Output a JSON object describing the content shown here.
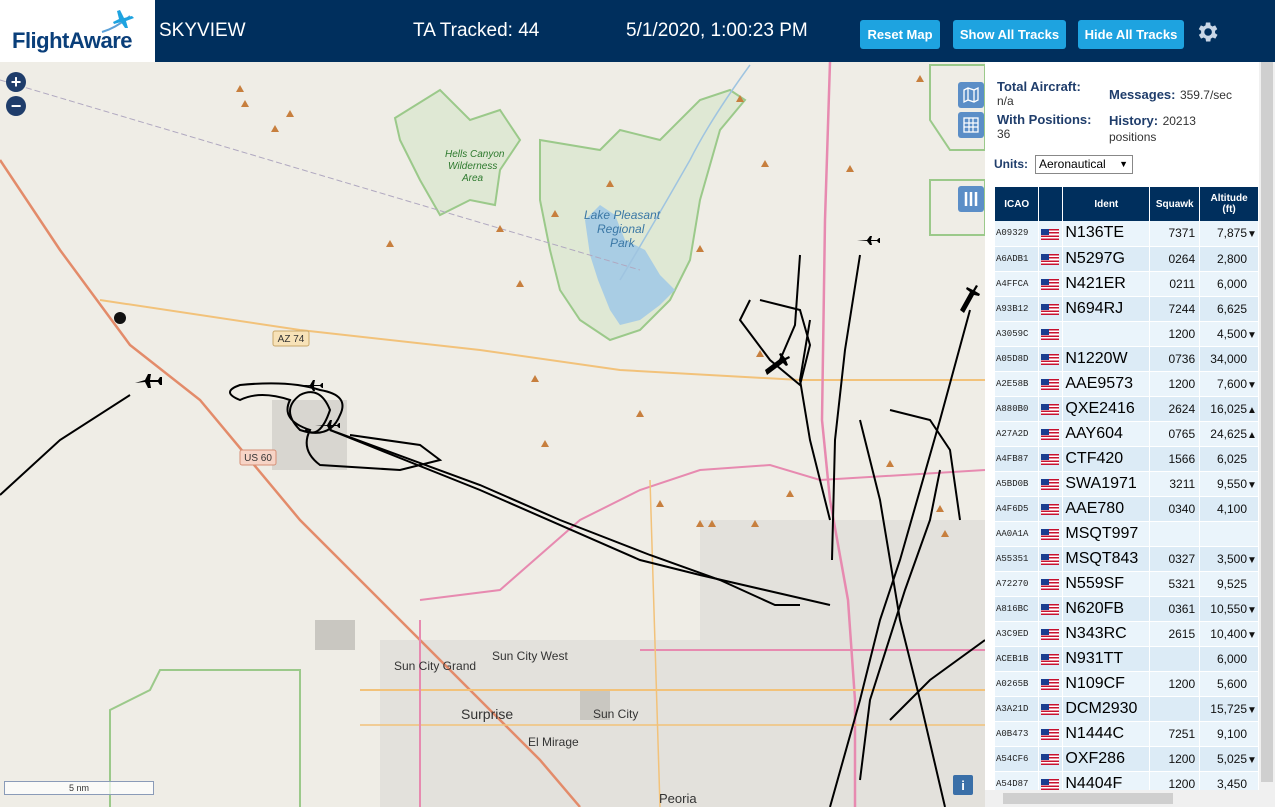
{
  "header": {
    "logo_text": "FlightAware",
    "app_title": "SKYVIEW",
    "ta_tracked": "TA Tracked: 44",
    "datetime": "5/1/2020, 1:00:23 PM",
    "reset_map": "Reset Map",
    "show_all_tracks": "Show All Tracks",
    "hide_all_tracks": "Hide All Tracks"
  },
  "stats": {
    "total_aircraft_label": "Total Aircraft:",
    "total_aircraft_value": "n/a",
    "with_positions_label": "With Positions:",
    "with_positions_value": "36",
    "messages_label": "Messages:",
    "messages_value": "359.7/sec",
    "history_label": "History:",
    "history_value": "20213",
    "history_unit": "positions",
    "units_label": "Units:",
    "units_value": "Aeronautical"
  },
  "table": {
    "headers": {
      "icao": "ICAO",
      "ident": "Ident",
      "squawk": "Squawk",
      "altitude": "Altitude",
      "altitude_unit": "(ft)"
    },
    "rows": [
      {
        "icao": "A09329",
        "ident": "N136TE",
        "squawk": "7371",
        "alt": "7,875",
        "trend": "▼"
      },
      {
        "icao": "A6ADB1",
        "ident": "N5297G",
        "squawk": "0264",
        "alt": "2,800",
        "trend": ""
      },
      {
        "icao": "A4FFCA",
        "ident": "N421ER",
        "squawk": "0211",
        "alt": "6,000",
        "trend": ""
      },
      {
        "icao": "A93B12",
        "ident": "N694RJ",
        "squawk": "7244",
        "alt": "6,625",
        "trend": ""
      },
      {
        "icao": "A3059C",
        "ident": "",
        "squawk": "1200",
        "alt": "4,500",
        "trend": "▼"
      },
      {
        "icao": "A05D8D",
        "ident": "N1220W",
        "squawk": "0736",
        "alt": "34,000",
        "trend": ""
      },
      {
        "icao": "A2E58B",
        "ident": "AAE9573",
        "squawk": "1200",
        "alt": "7,600",
        "trend": "▼"
      },
      {
        "icao": "A880B0",
        "ident": "QXE2416",
        "squawk": "2624",
        "alt": "16,025",
        "trend": "▲"
      },
      {
        "icao": "A27A2D",
        "ident": "AAY604",
        "squawk": "0765",
        "alt": "24,625",
        "trend": "▲"
      },
      {
        "icao": "A4FB87",
        "ident": "CTF420",
        "squawk": "1566",
        "alt": "6,025",
        "trend": ""
      },
      {
        "icao": "A5BD0B",
        "ident": "SWA1971",
        "squawk": "3211",
        "alt": "9,550",
        "trend": "▼"
      },
      {
        "icao": "A4F6D5",
        "ident": "AAE780",
        "squawk": "0340",
        "alt": "4,100",
        "trend": ""
      },
      {
        "icao": "AA0A1A",
        "ident": "MSQT997",
        "squawk": "",
        "alt": "",
        "trend": ""
      },
      {
        "icao": "A55351",
        "ident": "MSQT843",
        "squawk": "0327",
        "alt": "3,500",
        "trend": "▼"
      },
      {
        "icao": "A72270",
        "ident": "N559SF",
        "squawk": "5321",
        "alt": "9,525",
        "trend": ""
      },
      {
        "icao": "A816BC",
        "ident": "N620FB",
        "squawk": "0361",
        "alt": "10,550",
        "trend": "▼"
      },
      {
        "icao": "A3C9ED",
        "ident": "N343RC",
        "squawk": "2615",
        "alt": "10,400",
        "trend": "▼"
      },
      {
        "icao": "ACEB1B",
        "ident": "N931TT",
        "squawk": "",
        "alt": "6,000",
        "trend": ""
      },
      {
        "icao": "A0265B",
        "ident": "N109CF",
        "squawk": "1200",
        "alt": "5,600",
        "trend": ""
      },
      {
        "icao": "A3A21D",
        "ident": "DCM2930",
        "squawk": "",
        "alt": "15,725",
        "trend": "▼"
      },
      {
        "icao": "A0B473",
        "ident": "N1444C",
        "squawk": "7251",
        "alt": "9,100",
        "trend": ""
      },
      {
        "icao": "A54CF6",
        "ident": "OXF286",
        "squawk": "1200",
        "alt": "5,025",
        "trend": "▼"
      },
      {
        "icao": "A54D87",
        "ident": "N4404F",
        "squawk": "1200",
        "alt": "3,450",
        "trend": ""
      }
    ]
  },
  "map": {
    "scale": "5 nm",
    "labels": {
      "hells_canyon": "Hells Canyon",
      "wilderness": "Wilderness",
      "area": "Area",
      "lake_pleasant": "Lake Pleasant",
      "regional": "Regional",
      "park": "Park",
      "az74": "AZ 74",
      "us60": "US 60",
      "sun_city_grand": "Sun City Grand",
      "sun_city_west": "Sun City West",
      "surprise": "Surprise",
      "sun_city": "Sun City",
      "el_mirage": "El Mirage",
      "peoria": "Peoria"
    }
  }
}
